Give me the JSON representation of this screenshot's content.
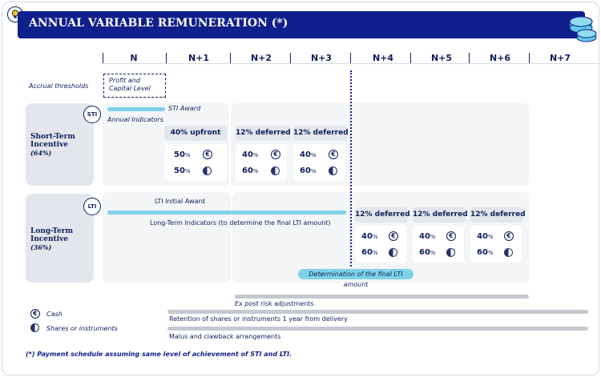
{
  "header": {
    "title": "ANNUAL VARIABLE REMUNERATION (*)"
  },
  "columns": [
    "N",
    "N+1",
    "N+2",
    "N+3",
    "N+4",
    "N+5",
    "N+6",
    "N+7"
  ],
  "accrual": {
    "label": "Accrual thresholds",
    "box_text": "Profit and Capital Level"
  },
  "sti": {
    "badge": "STI",
    "title": "Short-Term Incentive",
    "pct": "(64%)",
    "award_label": "STI Award",
    "indicators_label": "Annual Indicators",
    "payments": [
      {
        "chip": "40% upfront",
        "cash": "50",
        "shares": "50",
        "unit": "%"
      },
      {
        "chip": "12% deferred",
        "cash": "40",
        "shares": "60",
        "unit": "%"
      },
      {
        "chip": "12% deferred",
        "cash": "40",
        "shares": "60",
        "unit": "%"
      }
    ]
  },
  "lti": {
    "badge": "LTI",
    "title": "Long-Term Incentive",
    "pct": "(36%)",
    "award_label": "LTI Initial Award",
    "indicators_label": "Long-Term Indicators (to determine the final LTI amount)",
    "determination_label": "Determination of the final LTI amount",
    "payments": [
      {
        "chip": "12% deferred",
        "cash": "40",
        "shares": "60",
        "unit": "%"
      },
      {
        "chip": "12% deferred",
        "cash": "40",
        "shares": "60",
        "unit": "%"
      },
      {
        "chip": "12% deferred",
        "cash": "40",
        "shares": "60",
        "unit": "%"
      }
    ]
  },
  "legend": {
    "cash": "Cash",
    "shares": "Shares or instruments"
  },
  "bottom_rows": {
    "ex_post_italic": "Ex post",
    "ex_post_rest": " risk adjustments",
    "retention": "Retention of shares or instruments 1 year from delivery",
    "malus": "Malus and clawback arrangements"
  },
  "footnote": "(*) Payment schedule assuming same level of achievement of STI and LTI.",
  "colors": {
    "navy": "#0f1f8c",
    "cyan": "#7fd3e6",
    "panel": "#f4f5f7",
    "label_bg": "#e3e6ec"
  }
}
